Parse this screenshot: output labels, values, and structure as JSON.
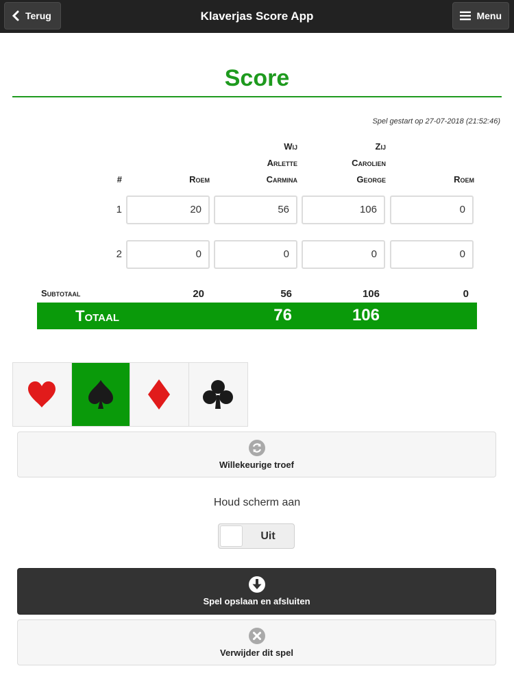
{
  "header": {
    "title": "Klaverjas Score App",
    "back_label": "Terug",
    "menu_label": "Menu"
  },
  "page": {
    "title": "Score",
    "started": "Spel gestart op 27-07-2018 (21:52:46)"
  },
  "table": {
    "headers": {
      "num": "#",
      "roem1": "Roem",
      "team1": [
        "Wij",
        "Arlette",
        "Carmina"
      ],
      "team2": [
        "Zij",
        "Carolien",
        "George"
      ],
      "roem2": "Roem"
    },
    "rows": [
      {
        "num": "1",
        "values": [
          "20",
          "56",
          "106",
          "0"
        ]
      },
      {
        "num": "2",
        "values": [
          "0",
          "0",
          "0",
          "0"
        ]
      }
    ],
    "subtotal": {
      "label": "Subtotaal",
      "values": [
        "20",
        "56",
        "106",
        "0"
      ]
    },
    "total": {
      "label": "Totaal",
      "wij": "76",
      "zij": "106"
    }
  },
  "suits": {
    "items": [
      "heart",
      "spade",
      "diamond",
      "club"
    ],
    "active": "spade",
    "colors": {
      "red": "#e11b1b",
      "black": "#1a1a1a",
      "active_bg": "#0a9a0a"
    }
  },
  "random_trump": {
    "label": "Willekeurige troef"
  },
  "keep_screen": {
    "label": "Houd scherm aan",
    "toggle": "Uit"
  },
  "save": {
    "label": "Spel opslaan en afsluiten"
  },
  "delete": {
    "label": "Verwijder dit spel"
  }
}
